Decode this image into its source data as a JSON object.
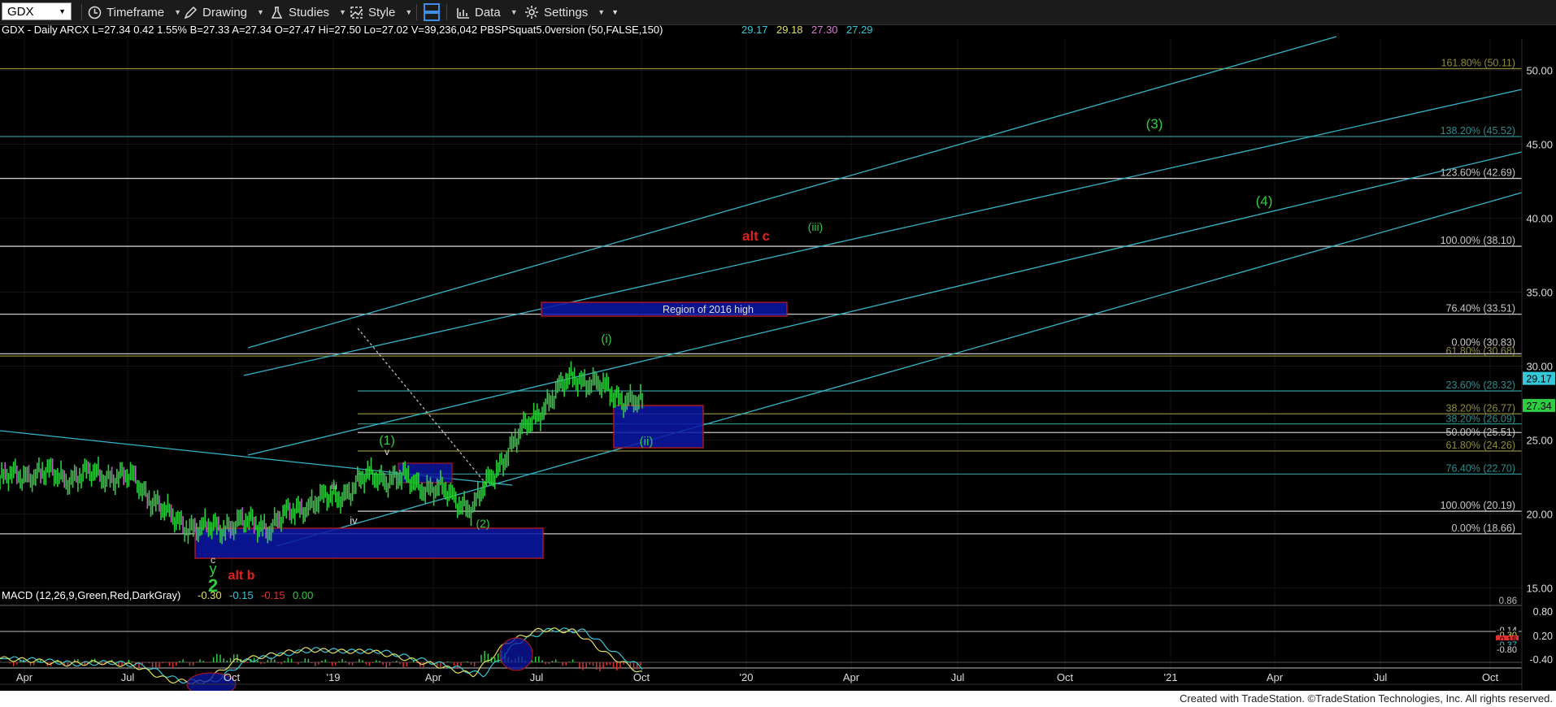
{
  "toolbar": {
    "symbol": "GDX",
    "timeframe": "Timeframe",
    "drawing": "Drawing",
    "studies": "Studies",
    "style": "Style",
    "data": "Data",
    "settings": "Settings"
  },
  "header": {
    "symbol_line": "GDX - Daily  ARCX  L=27.34  0.42  1.55%  B=27.33  A=27.34  O=27.47  Hi=27.50  Lo=27.02  V=39,236,042  PBSPSquat5.0version (50,FALSE,150)",
    "study_values": [
      "29.17",
      "29.18",
      "27.30",
      "27.29"
    ],
    "study_colors": [
      "#35c8d8",
      "#e0e060",
      "#d97ad9",
      "#35c8d8"
    ]
  },
  "macd": {
    "label": "MACD (12,26,9,Green,Red,DarkGray)",
    "values": [
      "-0.30",
      "-0.15",
      "-0.15",
      "0.00"
    ],
    "colors": [
      "#e0e060",
      "#35c8d8",
      "#e03030",
      "#2ecc40"
    ],
    "axis_ticks": [
      "0.80",
      "0.20",
      "-0.40"
    ],
    "top_level_label": "0.86",
    "tags": [
      "-0.14",
      "-0.30",
      "-0.15",
      "-0.37",
      "-0.80"
    ]
  },
  "price_axis": {
    "ticks": [
      "50.00",
      "45.00",
      "40.00",
      "35.00",
      "30.00",
      "25.00",
      "20.00",
      "15.00"
    ],
    "tag_study": "29.17",
    "tag_last": "27.34"
  },
  "time_axis": {
    "labels": [
      "Apr",
      "Jul",
      "Oct",
      "'19",
      "Apr",
      "Jul",
      "Oct",
      "'20",
      "Apr",
      "Jul",
      "Oct",
      "'21",
      "Apr",
      "Jul",
      "Oct"
    ]
  },
  "fib_levels": [
    {
      "label": "161.80% (50.11)",
      "price": 50.11,
      "color": "#8d8d3a"
    },
    {
      "label": "138.20% (45.52)",
      "price": 45.52,
      "color": "#2f8c8c"
    },
    {
      "label": "123.60% (42.69)",
      "price": 42.69,
      "color": "#c8c8c8"
    },
    {
      "label": "100.00% (38.10)",
      "price": 38.1,
      "color": "#c8c8c8"
    },
    {
      "label": "76.40% (33.51)",
      "price": 33.51,
      "color": "#c8c8c8"
    },
    {
      "label": "61.80% (30.68)",
      "price": 30.68,
      "color": "#8d8d3a"
    },
    {
      "label": "0.00% (30.83)",
      "price": 30.83,
      "color": "#c8c8c8"
    },
    {
      "label": "23.60% (28.32)",
      "price": 28.32,
      "color": "#2f8c8c"
    },
    {
      "label": "38.20% (26.77)",
      "price": 26.77,
      "color": "#8d8d3a"
    },
    {
      "label": "38.20% (26.09)",
      "price": 26.09,
      "color": "#2f8c8c"
    },
    {
      "label": "50.00% (25.51)",
      "price": 25.51,
      "color": "#c8c8c8"
    },
    {
      "label": "61.80% (24.26)",
      "price": 24.26,
      "color": "#8d8d3a"
    },
    {
      "label": "76.40% (22.70)",
      "price": 22.7,
      "color": "#2f8c8c"
    },
    {
      "label": "100.00% (20.19)",
      "price": 20.19,
      "color": "#c8c8c8"
    },
    {
      "label": "0.00% (18.66)",
      "price": 18.66,
      "color": "#c8c8c8"
    }
  ],
  "annotations": [
    {
      "text": "(3)",
      "color": "#2ecc40"
    },
    {
      "text": "(4)",
      "color": "#2ecc40"
    },
    {
      "text": "alt c",
      "color": "#e02020"
    },
    {
      "text": "(iii)",
      "color": "#2ecc40"
    },
    {
      "text": "(i)",
      "color": "#2ecc40"
    },
    {
      "text": "(ii)",
      "color": "#2ecc40"
    },
    {
      "text": "(1)",
      "color": "#2ecc40"
    },
    {
      "text": "(2)",
      "color": "#2ecc40"
    },
    {
      "text": "v",
      "color": "#dddddd"
    },
    {
      "text": "iii",
      "color": "#dddddd"
    },
    {
      "text": "iv",
      "color": "#dddddd"
    },
    {
      "text": "c",
      "color": "#dddddd"
    },
    {
      "text": "y",
      "color": "#2ecc40"
    },
    {
      "text": "2",
      "color": "#2ecc40"
    },
    {
      "text": "alt b",
      "color": "#e02020"
    }
  ],
  "region_label": "Region of 2016 high",
  "chart_data": {
    "type": "line",
    "symbol": "GDX",
    "interval": "Daily",
    "ylim": [
      13.5,
      51.5
    ],
    "x": [
      "2018-03",
      "2018-04",
      "2018-05",
      "2018-06",
      "2018-07",
      "2018-08",
      "2018-09",
      "2018-10",
      "2018-11",
      "2018-12",
      "2019-01",
      "2019-02",
      "2019-03",
      "2019-04",
      "2019-05",
      "2019-06",
      "2019-07",
      "2019-08",
      "2019-09",
      "2019-10"
    ],
    "series": [
      {
        "values": [
          22.3,
          22.8,
          22.5,
          22.7,
          22.3,
          19.8,
          18.9,
          19.4,
          19.2,
          20.6,
          21.2,
          22.6,
          22.3,
          21.6,
          20.4,
          24.2,
          27.1,
          29.4,
          28.3,
          27.34
        ]
      }
    ],
    "macd": {
      "values": [
        0.1,
        0.05,
        -0.05,
        0.0,
        -0.1,
        -0.5,
        -0.55,
        0.05,
        0.2,
        0.35,
        0.3,
        0.3,
        0.1,
        -0.1,
        -0.35,
        0.55,
        0.9,
        0.85,
        0.2,
        -0.3
      ]
    }
  }
}
